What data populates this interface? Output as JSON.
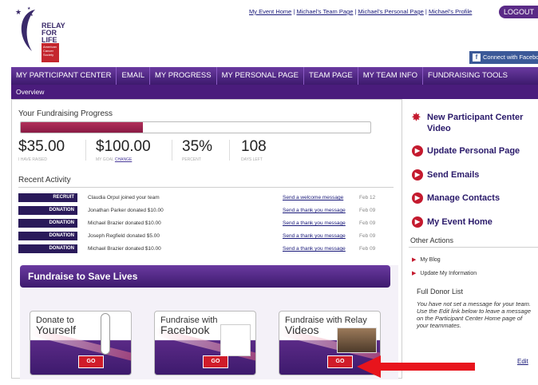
{
  "header": {
    "logo_text": "RELAY\nFOR LIFE",
    "logo_org": "American Cancer Society",
    "links": [
      "My Event Home",
      "Michael's Team Page",
      "Michael's Personal Page",
      "Michael's Profile"
    ],
    "logout": "LOGOUT",
    "facebook_connect": "Connect with Facebook"
  },
  "nav": {
    "items": [
      "MY PARTICIPANT CENTER",
      "EMAIL",
      "MY PROGRESS",
      "MY PERSONAL PAGE",
      "TEAM PAGE",
      "MY TEAM INFO",
      "FUNDRAISING TOOLS"
    ],
    "sub": "Overview"
  },
  "progress": {
    "title": "Your Fundraising Progress",
    "fill": 0.35,
    "raised": "$35.00",
    "raised_label": "I HAVE RAISED",
    "goal": "$100.00",
    "goal_label": "MY GOAL",
    "goal_change": "change",
    "percent": "35%",
    "percent_label": "PERCENT",
    "days": "108",
    "days_label": "DAYS LEFT"
  },
  "recent": {
    "title": "Recent Activity",
    "rows": [
      {
        "badge": "RECRUIT",
        "text": "Claudia Orpul joined your team",
        "link": "Send a welcome message",
        "date": "Feb 12"
      },
      {
        "badge": "DONATION",
        "text": "Jonathan Parker donated $10.00",
        "link": "Send a thank you message",
        "date": "Feb 09"
      },
      {
        "badge": "DONATION",
        "text": "Michael Brazier donated $10.00",
        "link": "Send a thank you message",
        "date": "Feb 09"
      },
      {
        "badge": "DONATION",
        "text": "Joseph Regfield donated $5.00",
        "link": "Send a thank you message",
        "date": "Feb 09"
      },
      {
        "badge": "DONATION",
        "text": "Michael Brazier donated $10.00",
        "link": "Send a thank you message",
        "date": "Feb 09"
      }
    ]
  },
  "fundraise": {
    "title": "Fundraise to Save Lives",
    "cards": [
      {
        "line1": "Donate to",
        "line2": "Yourself",
        "go": "GO"
      },
      {
        "line1": "Fundraise with",
        "line2": "Facebook",
        "go": "GO"
      },
      {
        "line1": "Fundraise with Relay",
        "line2": "Videos",
        "go": "GO"
      }
    ]
  },
  "sidebar": {
    "items": [
      "New Participant Center Video",
      "Update Personal Page",
      "Send Emails",
      "Manage Contacts",
      "My Event Home"
    ],
    "other_title": "Other Actions",
    "other_items": [
      "My Blog",
      "Update My Information"
    ],
    "donor_title": "Full Donor List",
    "donor_text": "You have not set a message for your team. Use the Edit link below to leave a message on the Participant Center Home page of your teammates.",
    "donor_edit": "Edit"
  },
  "colors": {
    "purple": "#4a1c7c",
    "red": "#c41a2e",
    "fb": "#3b5998"
  }
}
